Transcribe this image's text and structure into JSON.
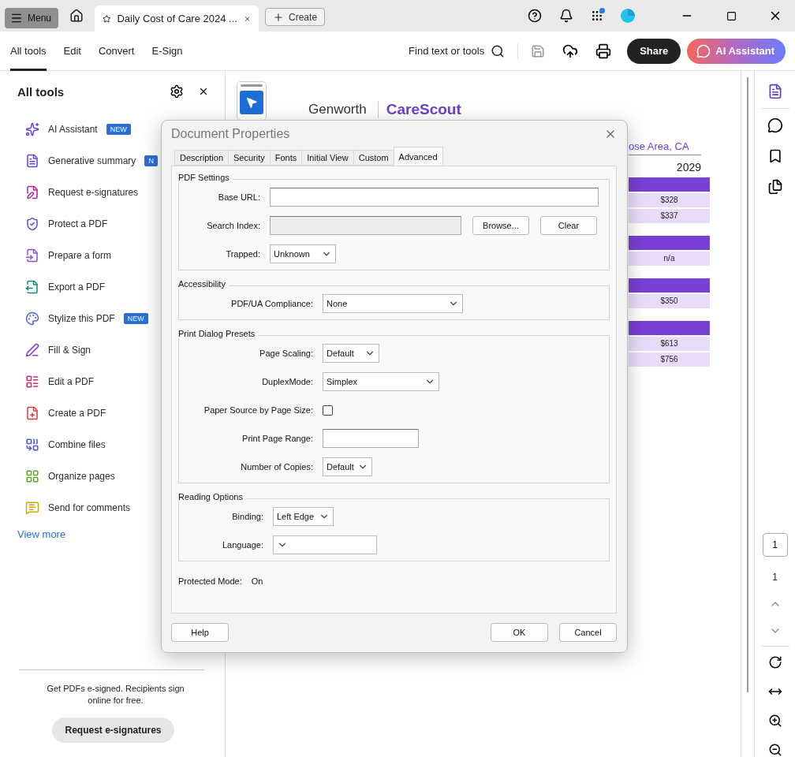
{
  "title_bar": {
    "menu": "Menu",
    "tab_title": "Daily Cost of Care 2024 ...",
    "create": "Create"
  },
  "toolbar": {
    "tabs": [
      {
        "label": "All tools",
        "selected": true
      },
      {
        "label": "Edit",
        "selected": false
      },
      {
        "label": "Convert",
        "selected": false
      },
      {
        "label": "E-Sign",
        "selected": false
      }
    ],
    "search": "Find text or tools",
    "share": "Share",
    "ai_assistant": "AI Assistant"
  },
  "sidebar": {
    "title": "All tools",
    "items": [
      {
        "label": "AI Assistant",
        "badge": "NEW",
        "color": "#6b3fd4"
      },
      {
        "label": "Generative summary",
        "badge": "N",
        "color": "#6b3fd4"
      },
      {
        "label": "Request e-signatures",
        "color": "#b5249a"
      },
      {
        "label": "Protect a PDF",
        "color": "#5a4fd0"
      },
      {
        "label": "Prepare a form",
        "color": "#8a4fd6"
      },
      {
        "label": "Export a PDF",
        "color": "#138a7e"
      },
      {
        "label": "Stylize this PDF",
        "badge": "NEW",
        "color": "#5060d8"
      },
      {
        "label": "Fill & Sign",
        "color": "#8a3fd0"
      },
      {
        "label": "Edit a PDF",
        "color": "#d02a78"
      },
      {
        "label": "Create a PDF",
        "color": "#d9393b"
      },
      {
        "label": "Combine files",
        "color": "#4a5ad6"
      },
      {
        "label": "Organize pages",
        "color": "#5aa82a"
      },
      {
        "label": "Send for comments",
        "color": "#d4a600"
      }
    ],
    "view_more": "View more",
    "promo": "Get PDFs e-signed. Recipients sign online for free.",
    "promo_button": "Request e-signatures"
  },
  "document": {
    "logo_left": "Genworth",
    "logo_right": "CareScout",
    "location": "ose Area, CA",
    "year": "2029",
    "groups": [
      [
        "$328",
        "$337"
      ],
      [
        "n/a"
      ],
      [
        "$350"
      ],
      [
        "$613",
        "$756"
      ]
    ]
  },
  "page_nav": {
    "current": "1",
    "total": "1"
  },
  "dialog": {
    "title": "Document Properties",
    "tabs": [
      {
        "label": "Description",
        "selected": false
      },
      {
        "label": "Security",
        "selected": false
      },
      {
        "label": "Fonts",
        "selected": false
      },
      {
        "label": "Initial View",
        "selected": false
      },
      {
        "label": "Custom",
        "selected": false
      },
      {
        "label": "Advanced",
        "selected": true
      }
    ],
    "sections": [
      {
        "title": "PDF Settings",
        "rows": [
          {
            "kind": "text",
            "label": "Base URL:",
            "disabled": false
          },
          {
            "kind": "text",
            "label": "Search Index:",
            "disabled": true,
            "buttons": [
              "Browse...",
              "Clear"
            ]
          },
          {
            "kind": "select",
            "label": "Trapped:",
            "value": "Unknown"
          }
        ]
      },
      {
        "title": "Accessibility",
        "rows": [
          {
            "kind": "select",
            "label": "PDF/UA Compliance:",
            "value": "None"
          }
        ]
      },
      {
        "title": "Print Dialog Presets",
        "rows": [
          {
            "kind": "select",
            "label": "Page Scaling:",
            "value": "Default"
          },
          {
            "kind": "select",
            "label": "DuplexMode:",
            "value": "Simplex"
          },
          {
            "kind": "checkbox",
            "label": "Paper Source by Page Size:",
            "checked": false
          },
          {
            "kind": "text",
            "label": "Print Page Range:",
            "disabled": false
          },
          {
            "kind": "select",
            "label": "Number of Copies:",
            "value": "Default"
          }
        ]
      },
      {
        "title": "Reading Options",
        "rows": [
          {
            "kind": "select",
            "label": "Binding:",
            "value": "Left Edge"
          },
          {
            "kind": "select",
            "label": "Language:"
          }
        ]
      }
    ],
    "protected_mode_label": "Protected Mode:",
    "protected_mode_value": "On",
    "buttons": [
      "Help",
      "OK",
      "Cancel"
    ]
  }
}
